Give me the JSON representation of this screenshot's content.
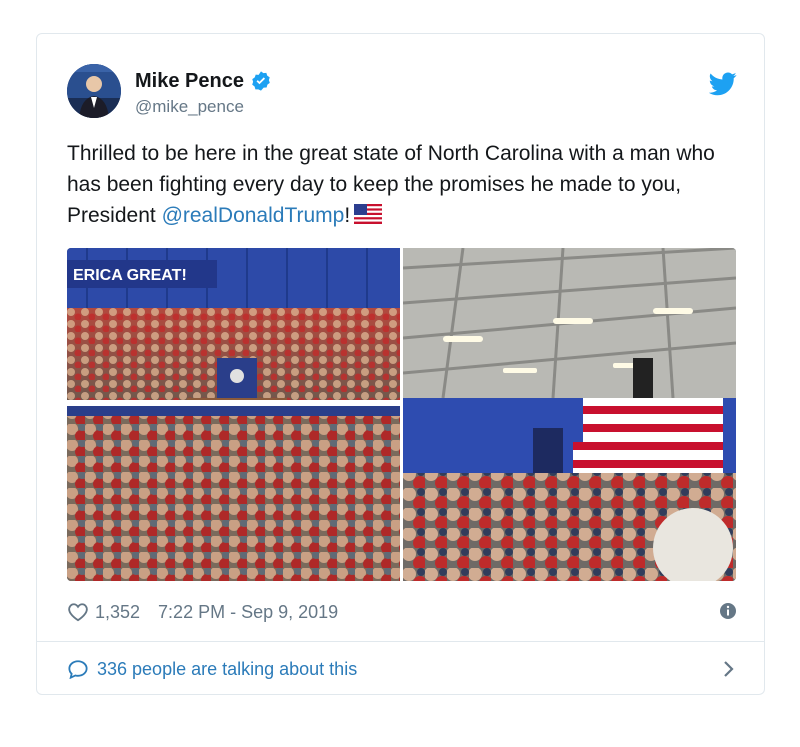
{
  "author": {
    "display_name": "Mike Pence",
    "handle": "@mike_pence",
    "verified": true
  },
  "tweet": {
    "text_before": "Thrilled to be here in the great state of North Carolina with a man who has been fighting every day to keep the promises he made to you, President ",
    "mention": "@realDonaldTrump",
    "text_after": "!"
  },
  "media": {
    "left_banner_text": "ERICA GREAT!"
  },
  "stats": {
    "likes": "1,352",
    "timestamp": "7:22 PM - Sep 9, 2019"
  },
  "footer": {
    "talking_label": "336 people are talking about this"
  },
  "colors": {
    "link": "#2b7bb9",
    "verified": "#1da1f2",
    "muted": "#657786",
    "border": "#e1e8ed"
  },
  "icons": {
    "bird": "twitter-bird-icon",
    "verified": "verified-badge-icon",
    "heart": "heart-outline-icon",
    "info": "info-icon",
    "comment": "comment-bubble-icon",
    "chevron": "chevron-right-icon",
    "flag": "us-flag-emoji"
  }
}
